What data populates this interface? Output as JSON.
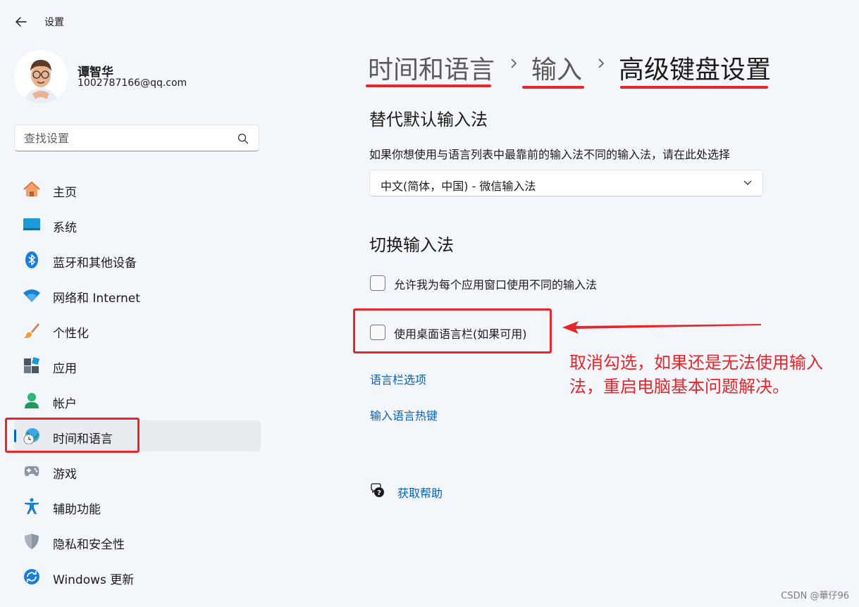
{
  "app": {
    "title": "设置"
  },
  "user": {
    "name": "谭智华",
    "email": "1002787166@qq.com"
  },
  "search": {
    "placeholder": "查找设置"
  },
  "nav": {
    "items": [
      {
        "label": "主页",
        "icon": "home-icon"
      },
      {
        "label": "系统",
        "icon": "system-icon"
      },
      {
        "label": "蓝牙和其他设备",
        "icon": "bluetooth-icon"
      },
      {
        "label": "网络和 Internet",
        "icon": "wifi-icon"
      },
      {
        "label": "个性化",
        "icon": "brush-icon"
      },
      {
        "label": "应用",
        "icon": "apps-icon"
      },
      {
        "label": "帐户",
        "icon": "account-icon"
      },
      {
        "label": "时间和语言",
        "icon": "time-language-icon",
        "selected": true
      },
      {
        "label": "游戏",
        "icon": "gamepad-icon"
      },
      {
        "label": "辅助功能",
        "icon": "accessibility-icon"
      },
      {
        "label": "隐私和安全性",
        "icon": "shield-icon"
      },
      {
        "label": "Windows 更新",
        "icon": "update-icon"
      }
    ]
  },
  "breadcrumb": {
    "items": [
      "时间和语言",
      "输入",
      "高级键盘设置"
    ]
  },
  "sections": {
    "override": {
      "title": "替代默认输入法",
      "description": "如果你想使用与语言列表中最靠前的输入法不同的输入法，请在此处选择",
      "dropdown_value": "中文(简体，中国) - 微信输入法"
    },
    "switching": {
      "title": "切换输入法",
      "checkbox_per_app": {
        "label": "允许我为每个应用窗口使用不同的输入法",
        "checked": false
      },
      "checkbox_language_bar": {
        "label": "使用桌面语言栏(如果可用)",
        "checked": false
      },
      "link_language_bar_options": "语言栏选项",
      "link_input_hotkeys": "输入语言热键"
    }
  },
  "help": {
    "label": "获取帮助"
  },
  "annotation": {
    "text": "取消勾选，如果还是无法使用输入法，重启电脑基本问题解决。",
    "color": "#e8262a"
  },
  "watermark": "CSDN @華仔96",
  "colors": {
    "accent": "#0067c0",
    "link": "#0a5fb3",
    "annotation": "#e8262a",
    "background": "#f3f6fb"
  }
}
